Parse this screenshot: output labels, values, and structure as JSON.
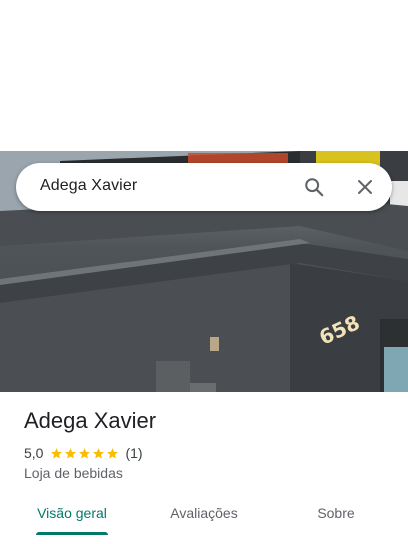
{
  "search": {
    "query": "Adega Xavier",
    "search_icon": "search-icon",
    "close_icon": "close-icon"
  },
  "photo": {
    "storefront_number": "658"
  },
  "place": {
    "name": "Adega Xavier",
    "rating": "5,0",
    "stars": 5,
    "review_count": "(1)",
    "category": "Loja de bebidas"
  },
  "tabs": [
    {
      "label": "Visão geral",
      "active": true
    },
    {
      "label": "Avaliações",
      "active": false
    },
    {
      "label": "Sobre",
      "active": false
    }
  ],
  "colors": {
    "accent": "#00796b",
    "star": "#fbbc04",
    "text_primary": "#202124",
    "text_secondary": "#5f6368"
  }
}
